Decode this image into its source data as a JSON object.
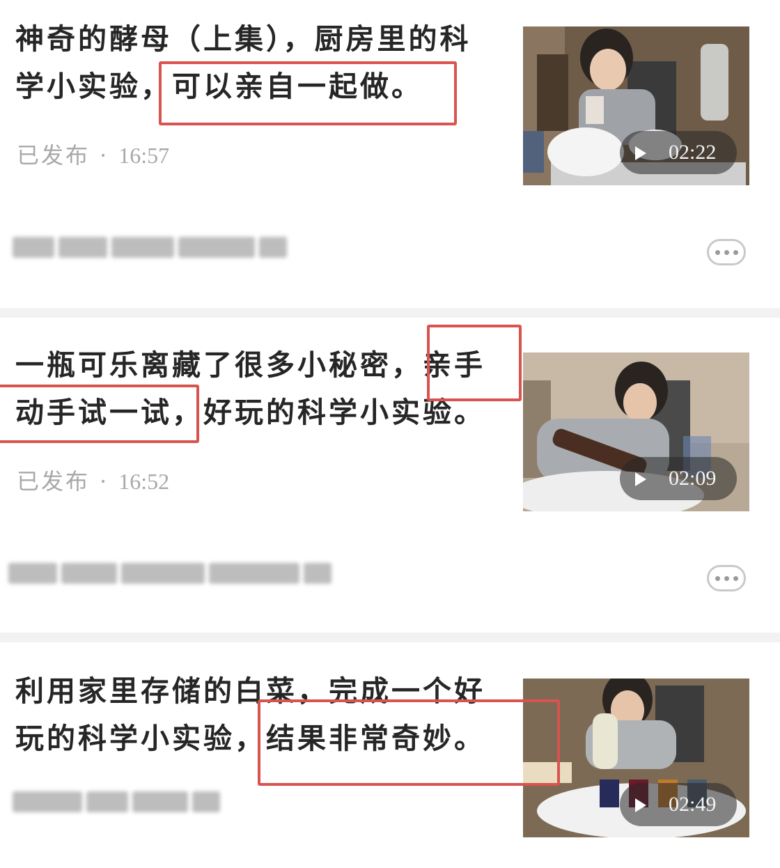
{
  "articles": [
    {
      "title_lines": [
        "神奇的酵母（上集），厨房里的科",
        "学小实验，可以亲自一起做。"
      ],
      "status": "已发布",
      "separator": "·",
      "time": "16:57",
      "duration": "02:22"
    },
    {
      "title_lines": [
        "一瓶可乐离藏了很多小秘密，亲手",
        "动手试一试，好玩的科学小实验。"
      ],
      "status": "已发布",
      "separator": "·",
      "time": "16:52",
      "duration": "02:09"
    },
    {
      "title_lines": [
        "利用家里存储的白菜，完成一个好",
        "玩的科学小实验，结果非常奇妙。"
      ],
      "duration": "02:49"
    }
  ],
  "colors": {
    "highlight": "#d9534f",
    "meta_text": "#a8a8a8",
    "separator": "#f2f2f2"
  },
  "icons": {
    "play": "play-icon",
    "more": "more-dots-icon"
  }
}
